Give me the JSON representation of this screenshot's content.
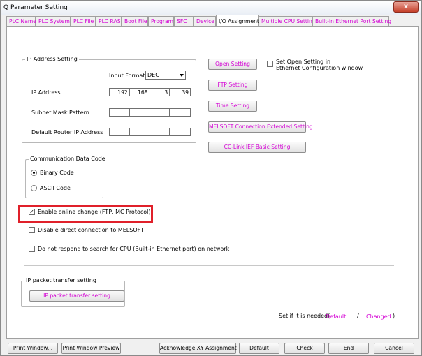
{
  "window": {
    "title": "Q Parameter Setting",
    "close_glyph": "x"
  },
  "tabs": [
    "PLC Name",
    "PLC System",
    "PLC File",
    "PLC RAS",
    "Boot File",
    "Program",
    "SFC",
    "Device",
    "I/O Assignment",
    "Multiple CPU Setting",
    "Built-in Ethernet Port Setting"
  ],
  "ip_setting": {
    "group_label": "IP Address Setting",
    "input_format_label": "Input Format",
    "input_format_value": "DEC",
    "ip_address_label": "IP Address",
    "ip_address": [
      "192",
      "168",
      "3",
      "39"
    ],
    "subnet_label": "Subnet Mask Pattern",
    "subnet": [
      "",
      "",
      "",
      ""
    ],
    "router_label": "Default Router IP Address",
    "router": [
      "",
      "",
      "",
      ""
    ]
  },
  "right_buttons": {
    "open_setting": "Open Setting",
    "ftp_setting": "FTP Setting",
    "time_setting": "Time Setting",
    "melsoft_ext": "MELSOFT Connection Extended Setting",
    "cclink_ief": "CC-Link IEF Basic Setting"
  },
  "open_setting_check": {
    "line1": "Set Open Setting in",
    "line2": "Ethernet Configuration window",
    "checked": false
  },
  "comm_code": {
    "group_label": "Communication Data Code",
    "binary": "Binary Code",
    "ascii": "ASCII Code",
    "selected": "binary"
  },
  "options": {
    "online_change": {
      "label": "Enable online change (FTP, MC Protocol)",
      "checked": true
    },
    "disable_direct": {
      "label": "Disable direct connection to MELSOFT",
      "checked": false
    },
    "no_respond": {
      "label": "Do not respond to search for CPU (Built-in Ethernet port) on network",
      "checked": false
    }
  },
  "ip_packet": {
    "group_label": "IP packet transfer setting",
    "button": "IP packet transfer setting"
  },
  "legend": {
    "prefix": "Set if it is needed(",
    "default": "Default",
    "slash": "/",
    "changed": "Changed",
    "suffix": ")"
  },
  "bottom_buttons": {
    "print_window": "Print Window...",
    "print_preview": "Print Window Preview",
    "acknowledge": "Acknowledge XY Assignment",
    "default": "Default",
    "check": "Check",
    "end": "End",
    "cancel": "Cancel"
  }
}
